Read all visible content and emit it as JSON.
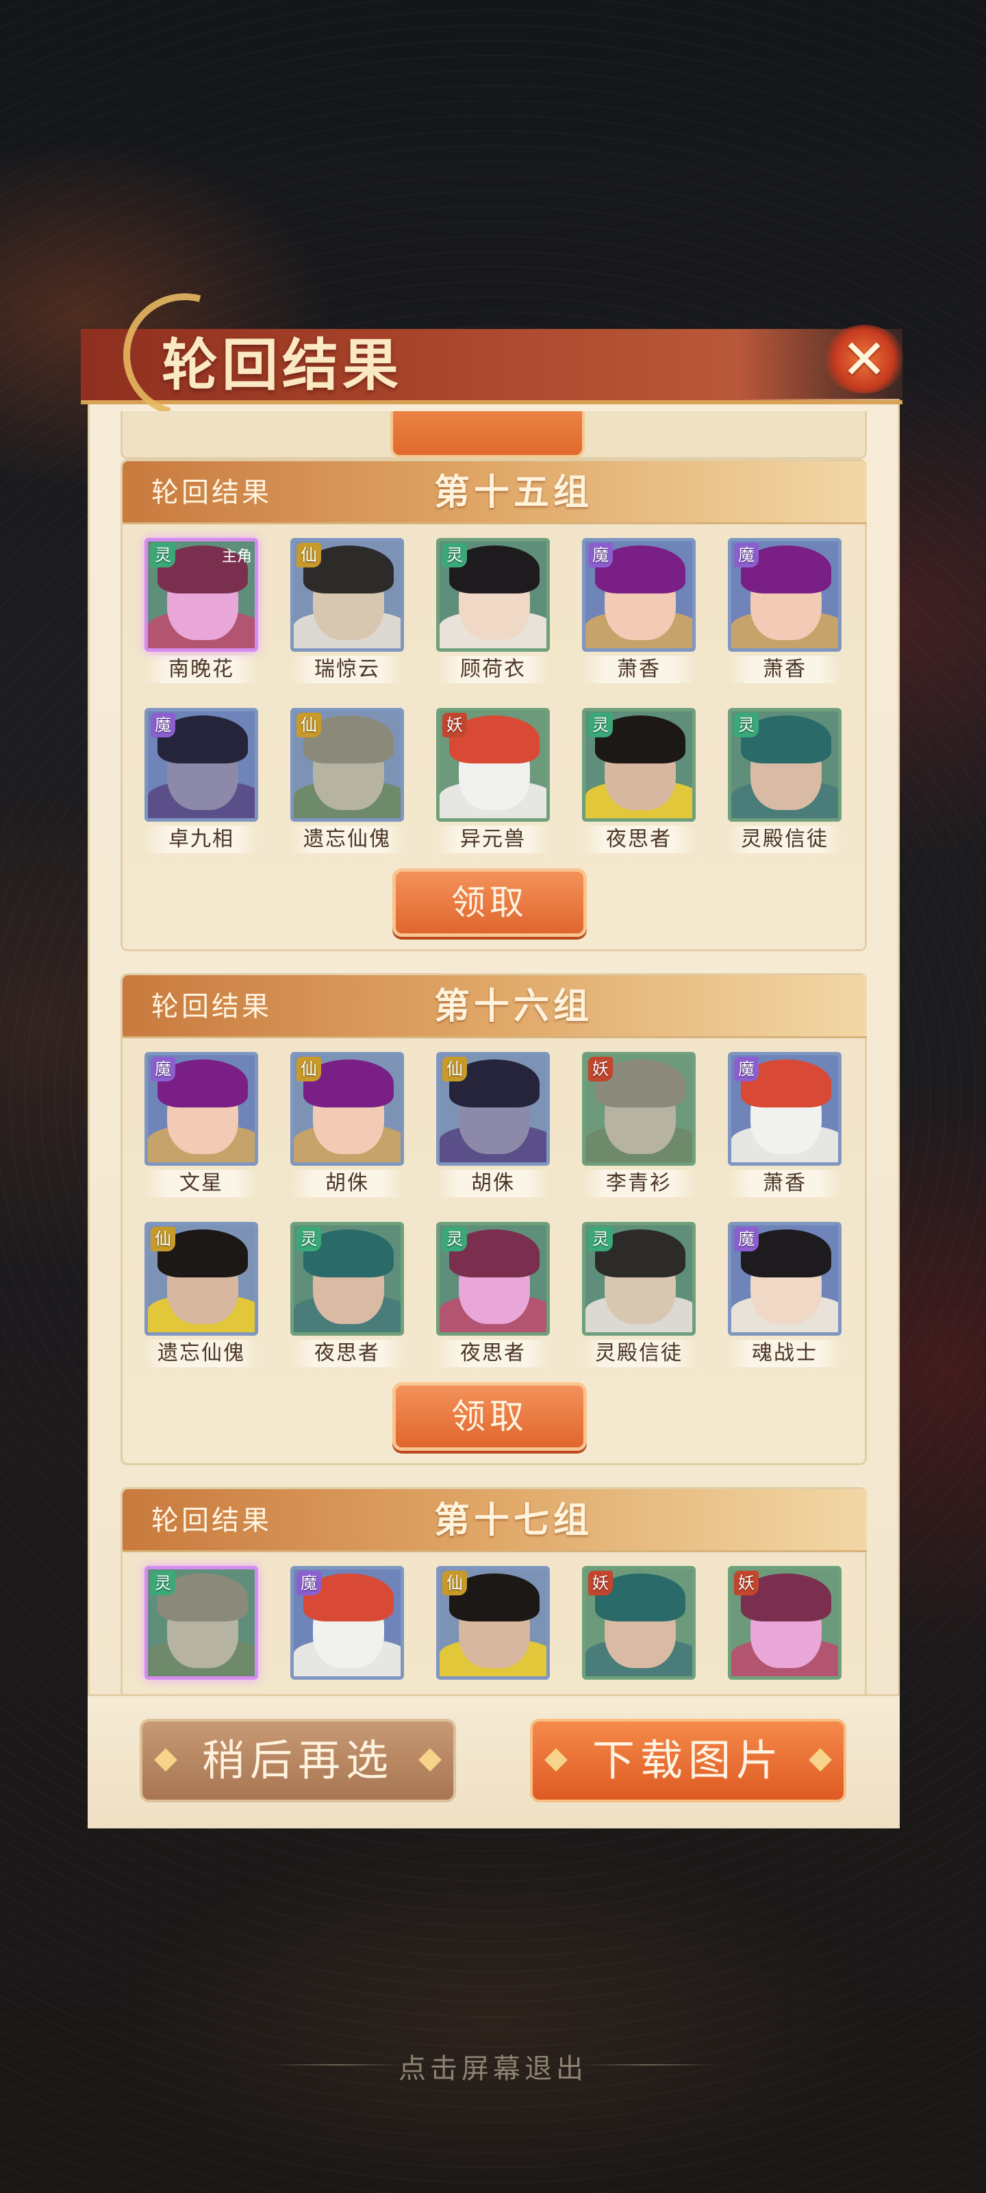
{
  "title": "轮回结果",
  "close_icon": "close-x-icon",
  "groups": [
    {
      "label": "轮回结果",
      "name": "第十五组",
      "claim": "领取",
      "heroes": [
        {
          "name": "南晚花",
          "faction": "灵",
          "tag": "主角"
        },
        {
          "name": "瑞惊云",
          "faction": "仙"
        },
        {
          "name": "顾荷衣",
          "faction": "灵"
        },
        {
          "name": "萧香",
          "faction": "魔"
        },
        {
          "name": "萧香",
          "faction": "魔"
        },
        {
          "name": "卓九相",
          "faction": "魔"
        },
        {
          "name": "遗忘仙傀",
          "faction": "仙"
        },
        {
          "name": "异元兽",
          "faction": "妖"
        },
        {
          "name": "夜思者",
          "faction": "灵"
        },
        {
          "name": "灵殿信徒",
          "faction": "灵"
        }
      ]
    },
    {
      "label": "轮回结果",
      "name": "第十六组",
      "claim": "领取",
      "heroes": [
        {
          "name": "文星",
          "faction": "魔"
        },
        {
          "name": "胡侏",
          "faction": "仙"
        },
        {
          "name": "胡侏",
          "faction": "仙"
        },
        {
          "name": "李青衫",
          "faction": "妖"
        },
        {
          "name": "萧香",
          "faction": "魔"
        },
        {
          "name": "遗忘仙傀",
          "faction": "仙"
        },
        {
          "name": "夜思者",
          "faction": "灵"
        },
        {
          "name": "夜思者",
          "faction": "灵"
        },
        {
          "name": "灵殿信徒",
          "faction": "灵"
        },
        {
          "name": "魂战士",
          "faction": "魔"
        }
      ]
    },
    {
      "label": "轮回结果",
      "name": "第十七组",
      "heroes": [
        {
          "faction": "灵"
        },
        {
          "faction": "魔"
        },
        {
          "faction": "仙"
        },
        {
          "faction": "妖"
        },
        {
          "faction": "妖"
        }
      ]
    }
  ],
  "buttons": {
    "later": "稍后再选",
    "download": "下载图片"
  },
  "exit_hint": "点击屏幕退出"
}
